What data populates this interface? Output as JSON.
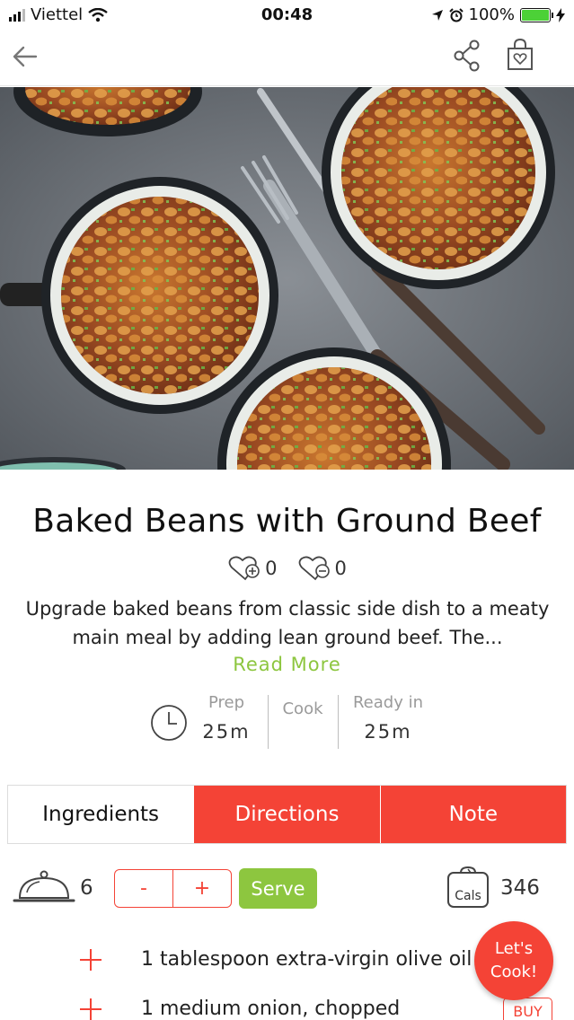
{
  "status_bar": {
    "carrier": "Viettel",
    "time": "00:48",
    "battery": "100%",
    "battery_level": 1.0
  },
  "recipe": {
    "title": "Baked Beans with Ground Beef",
    "likes": "0",
    "dislikes": "0",
    "description": "Upgrade baked beans from classic side dish to a meaty main meal by adding lean ground beef. The...",
    "read_more": "Read More",
    "times": {
      "prep_label": "Prep",
      "prep_value": "25m",
      "cook_label": "Cook",
      "cook_value": "",
      "ready_label": "Ready in",
      "ready_value": "25m"
    }
  },
  "tabs": [
    {
      "label": "Ingredients",
      "active": true
    },
    {
      "label": "Directions",
      "active": false
    },
    {
      "label": "Note",
      "active": false
    }
  ],
  "servings": {
    "count": "6",
    "minus": "-",
    "plus": "+",
    "serve_label": "Serve",
    "cals_icon_text": "Cals",
    "calories": "346"
  },
  "ingredients": [
    {
      "text": "1 tablespoon extra-virgin olive oil"
    },
    {
      "text": "1 medium onion, chopped"
    }
  ],
  "buy_label": "BUY",
  "fab_label": "Let's Cook!",
  "colors": {
    "accent_red": "#f44336",
    "accent_green": "#8dc63f"
  }
}
